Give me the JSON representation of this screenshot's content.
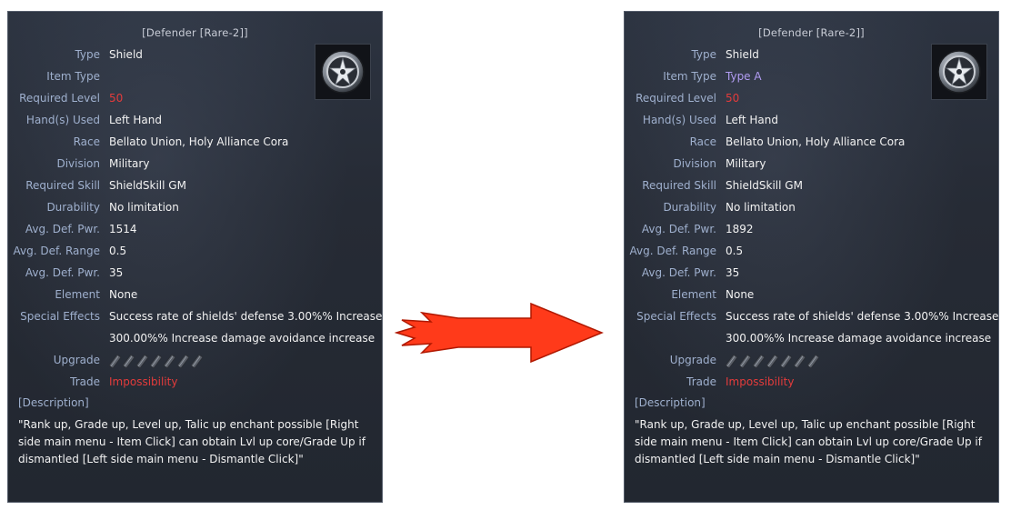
{
  "panels": [
    {
      "title": "[Defender [Rare-2]]",
      "rows": [
        {
          "label": "Type",
          "value": "Shield"
        },
        {
          "label": "Item Type",
          "value": ""
        },
        {
          "label": "Required Level",
          "value": "50"
        },
        {
          "label": "Hand(s) Used",
          "value": "Left Hand"
        },
        {
          "label": "Race",
          "value": "Bellato Union, Holy Alliance Cora"
        },
        {
          "label": "Division",
          "value": "Military"
        },
        {
          "label": "Required Skill",
          "value": "ShieldSkill GM"
        },
        {
          "label": "Durability",
          "value": "No limitation"
        },
        {
          "label": "Avg. Def. Pwr.",
          "value": "1514"
        },
        {
          "label": "Avg. Def. Range",
          "value": "0.5"
        },
        {
          "label": "Avg. Def. Pwr.",
          "value": "35"
        },
        {
          "label": "Element",
          "value": "None"
        },
        {
          "label": "Special Effects",
          "value": "Success rate of shields' defense 3.00%% Increase"
        },
        {
          "label": "",
          "value": "300.00%% Increase damage avoidance increase"
        },
        {
          "label": "Upgrade",
          "value": ""
        },
        {
          "label": "Trade",
          "value": "Impossibility"
        }
      ],
      "description_header": "[Description]",
      "description": "\"Rank up, Grade up, Level up, Talic up enchant possible [Right side main menu - Item Click] can obtain Lvl up core/Grade Up if dismantled [Left side main menu - Dismantle Click]\""
    },
    {
      "title": "[Defender [Rare-2]]",
      "rows": [
        {
          "label": "Type",
          "value": "Shield"
        },
        {
          "label": "Item Type",
          "value": "Type A"
        },
        {
          "label": "Required Level",
          "value": "50"
        },
        {
          "label": "Hand(s) Used",
          "value": "Left Hand"
        },
        {
          "label": "Race",
          "value": "Bellato Union, Holy Alliance Cora"
        },
        {
          "label": "Division",
          "value": "Military"
        },
        {
          "label": "Required Skill",
          "value": "ShieldSkill GM"
        },
        {
          "label": "Durability",
          "value": "No limitation"
        },
        {
          "label": "Avg. Def. Pwr.",
          "value": "1892"
        },
        {
          "label": "Avg. Def. Range",
          "value": "0.5"
        },
        {
          "label": "Avg. Def. Pwr.",
          "value": "35"
        },
        {
          "label": "Element",
          "value": "None"
        },
        {
          "label": "Special Effects",
          "value": "Success rate of shields' defense 3.00%% Increase"
        },
        {
          "label": "",
          "value": "300.00%% Increase damage avoidance increase"
        },
        {
          "label": "Upgrade",
          "value": ""
        },
        {
          "label": "Trade",
          "value": "Impossibility"
        }
      ],
      "description_header": "[Description]",
      "description": "\"Rank up, Grade up, Level up, Talic up enchant possible [Right side main menu - Item Click] can obtain Lvl up core/Grade Up if dismantled [Left side main menu - Dismantle Click]\""
    }
  ],
  "colors": {
    "label": "#9fb0ce",
    "value": "#f2f2f2",
    "red": "#e33b3b",
    "purple": "#b19cf2",
    "arrow": "#ff3a1a"
  },
  "icons": {
    "item": "shield-star-icon",
    "upgrade_slot": "empty-talic-slot-icon",
    "arrow": "right-arrow-icon"
  }
}
